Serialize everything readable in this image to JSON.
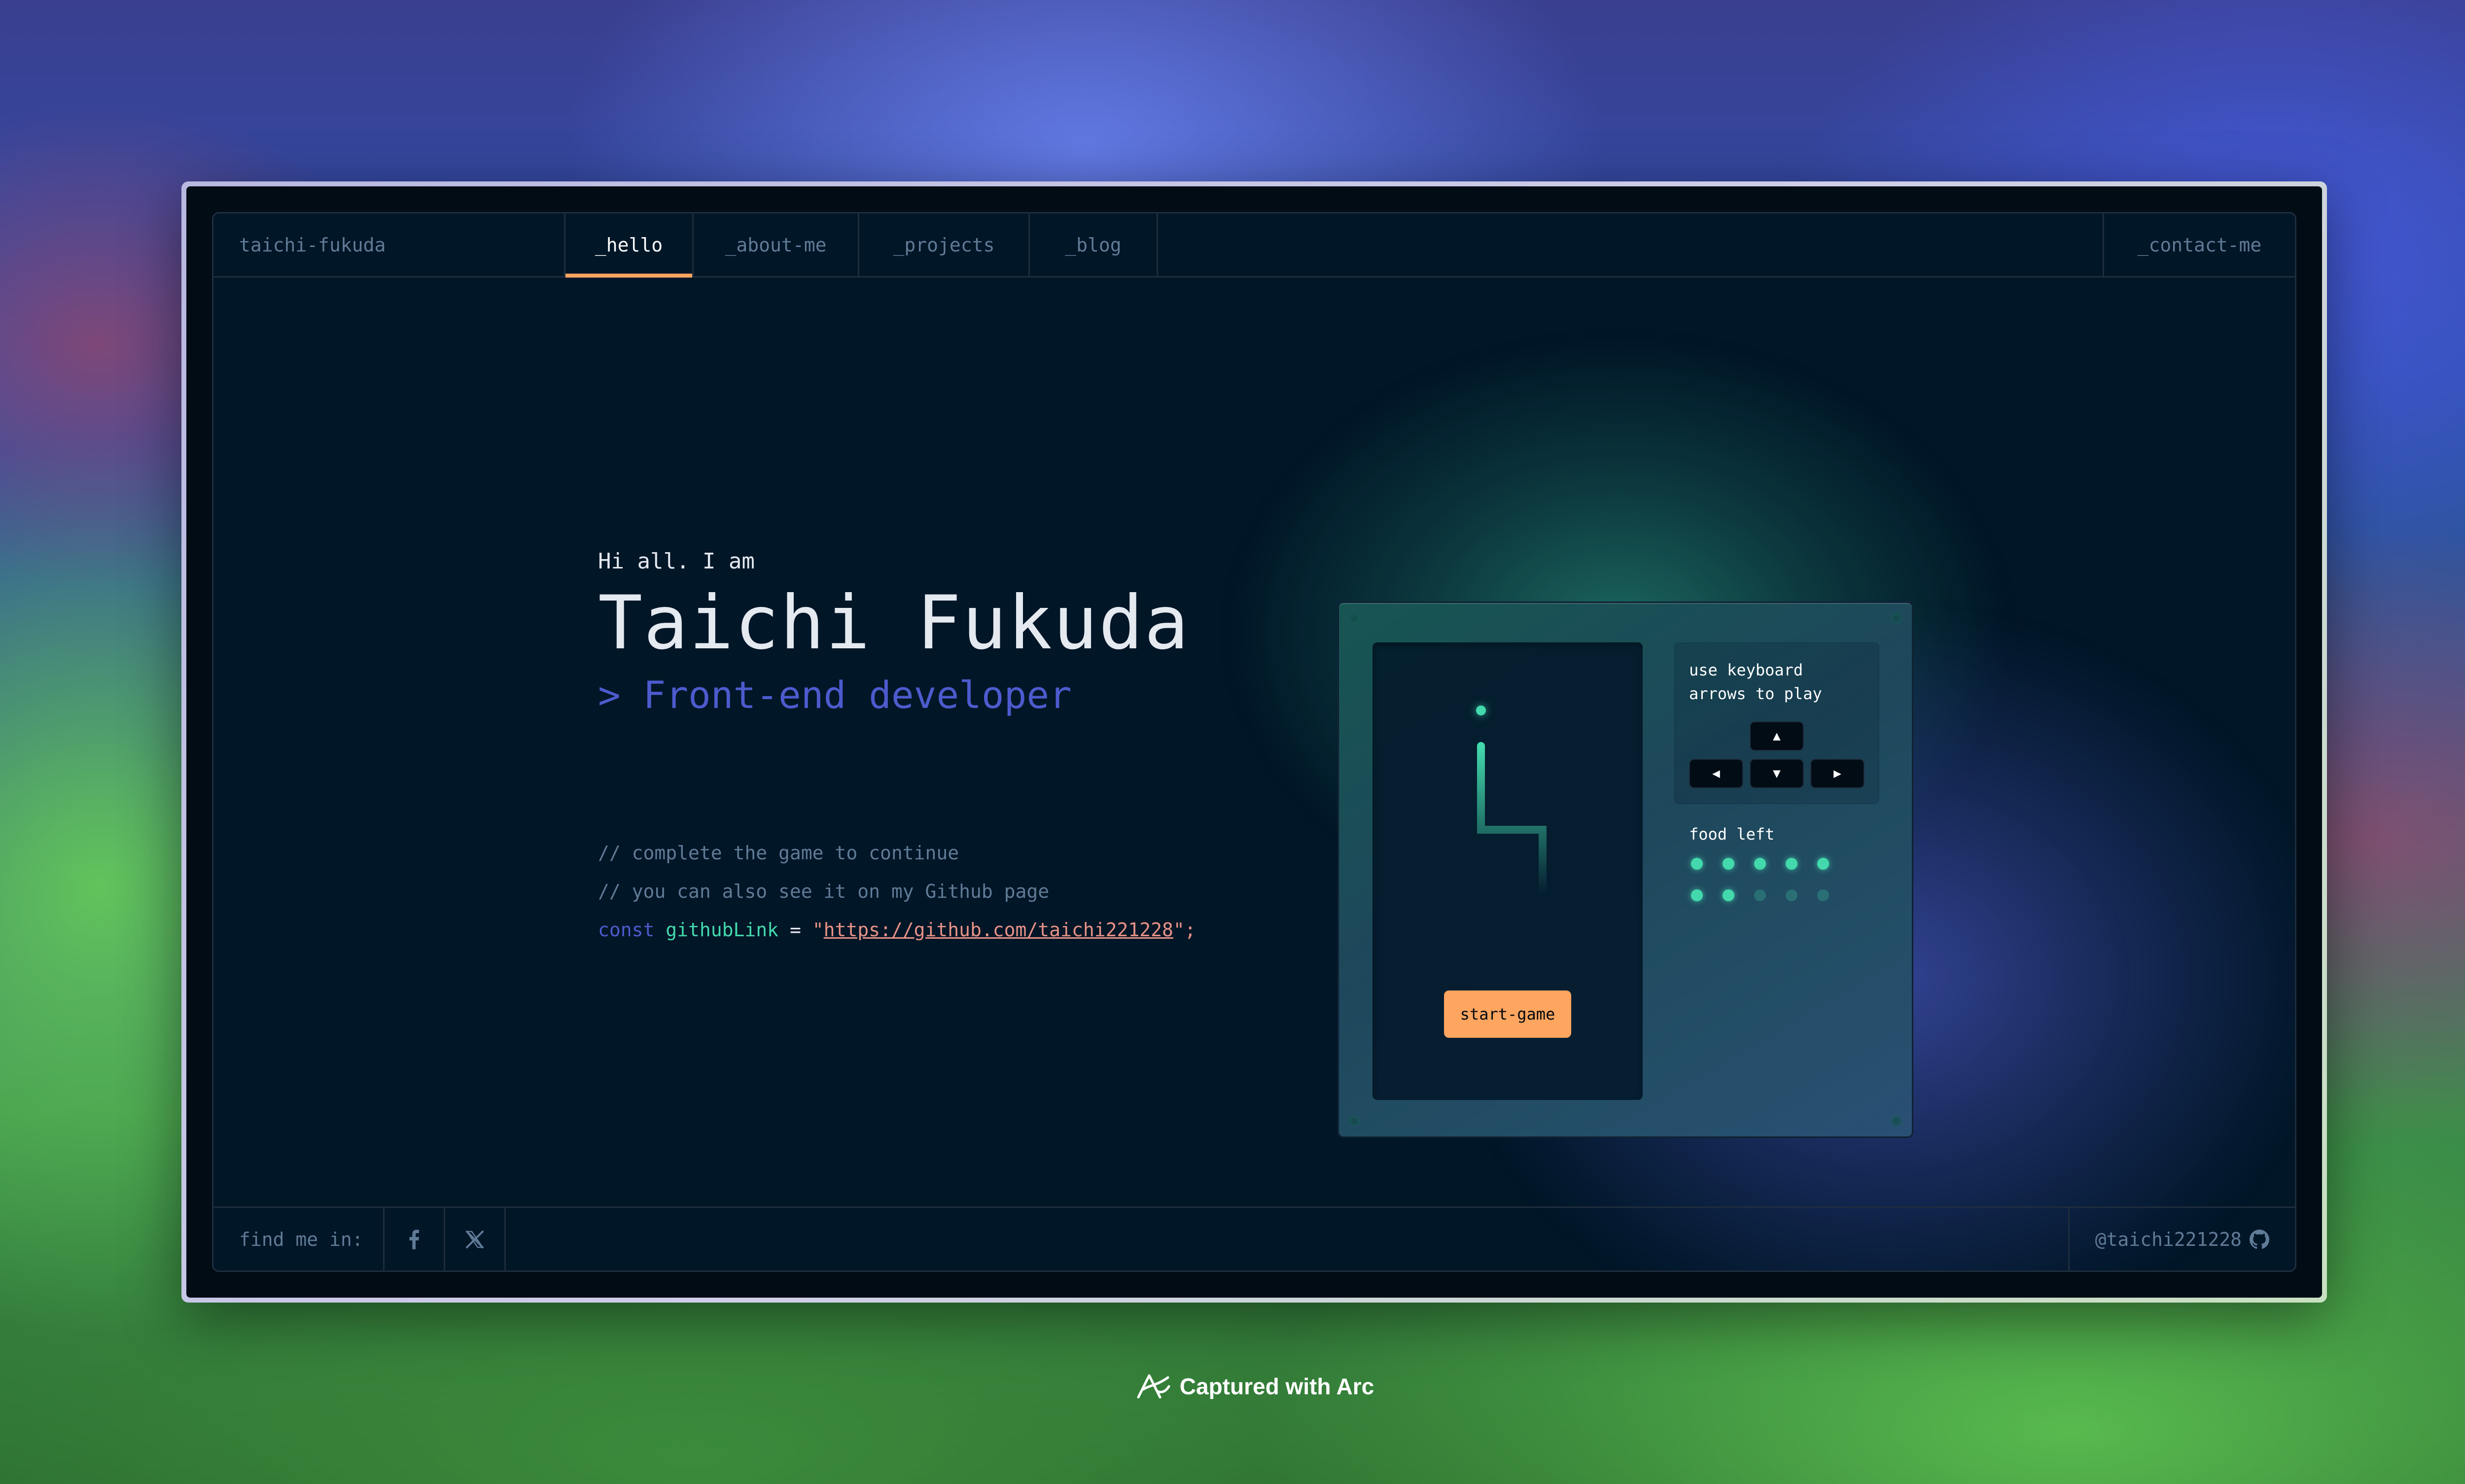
{
  "nav": {
    "name": "taichi-fukuda",
    "tabs": [
      {
        "label": "_hello"
      },
      {
        "label": "_about-me"
      },
      {
        "label": "_projects"
      },
      {
        "label": "_blog"
      }
    ],
    "contact": "_contact-me"
  },
  "hero": {
    "greeting": "Hi all. I am",
    "name": "Taichi Fukuda",
    "role": "> Front-end developer"
  },
  "code": {
    "comment1": "// complete the game to continue",
    "comment2": "// you can also see it on my Github page",
    "keyword": "const",
    "variable": "githubLink",
    "operator": "=",
    "quote_open": "\"",
    "link": "https://github.com/taichi221228",
    "quote_close": "\";"
  },
  "game": {
    "start_label": "start-game",
    "instructions_line1": "use keyboard",
    "instructions_line2": "arrows to play",
    "keys": {
      "up": "▲",
      "left": "◀",
      "down": "▼",
      "right": "▶"
    },
    "food_label": "food left",
    "food_total": 10,
    "food_remaining": 7
  },
  "footer": {
    "label": "find me in:",
    "social": [
      "facebook-icon",
      "x-icon"
    ],
    "handle": "@taichi221228",
    "handle_icon": "github-icon"
  },
  "badge": {
    "text": "Captured with Arc"
  },
  "colors": {
    "accent_orange": "#fea55f",
    "accent_green": "#43d9ad",
    "accent_blue": "#4d5bce",
    "background": "#011627",
    "link": "#e99287"
  }
}
